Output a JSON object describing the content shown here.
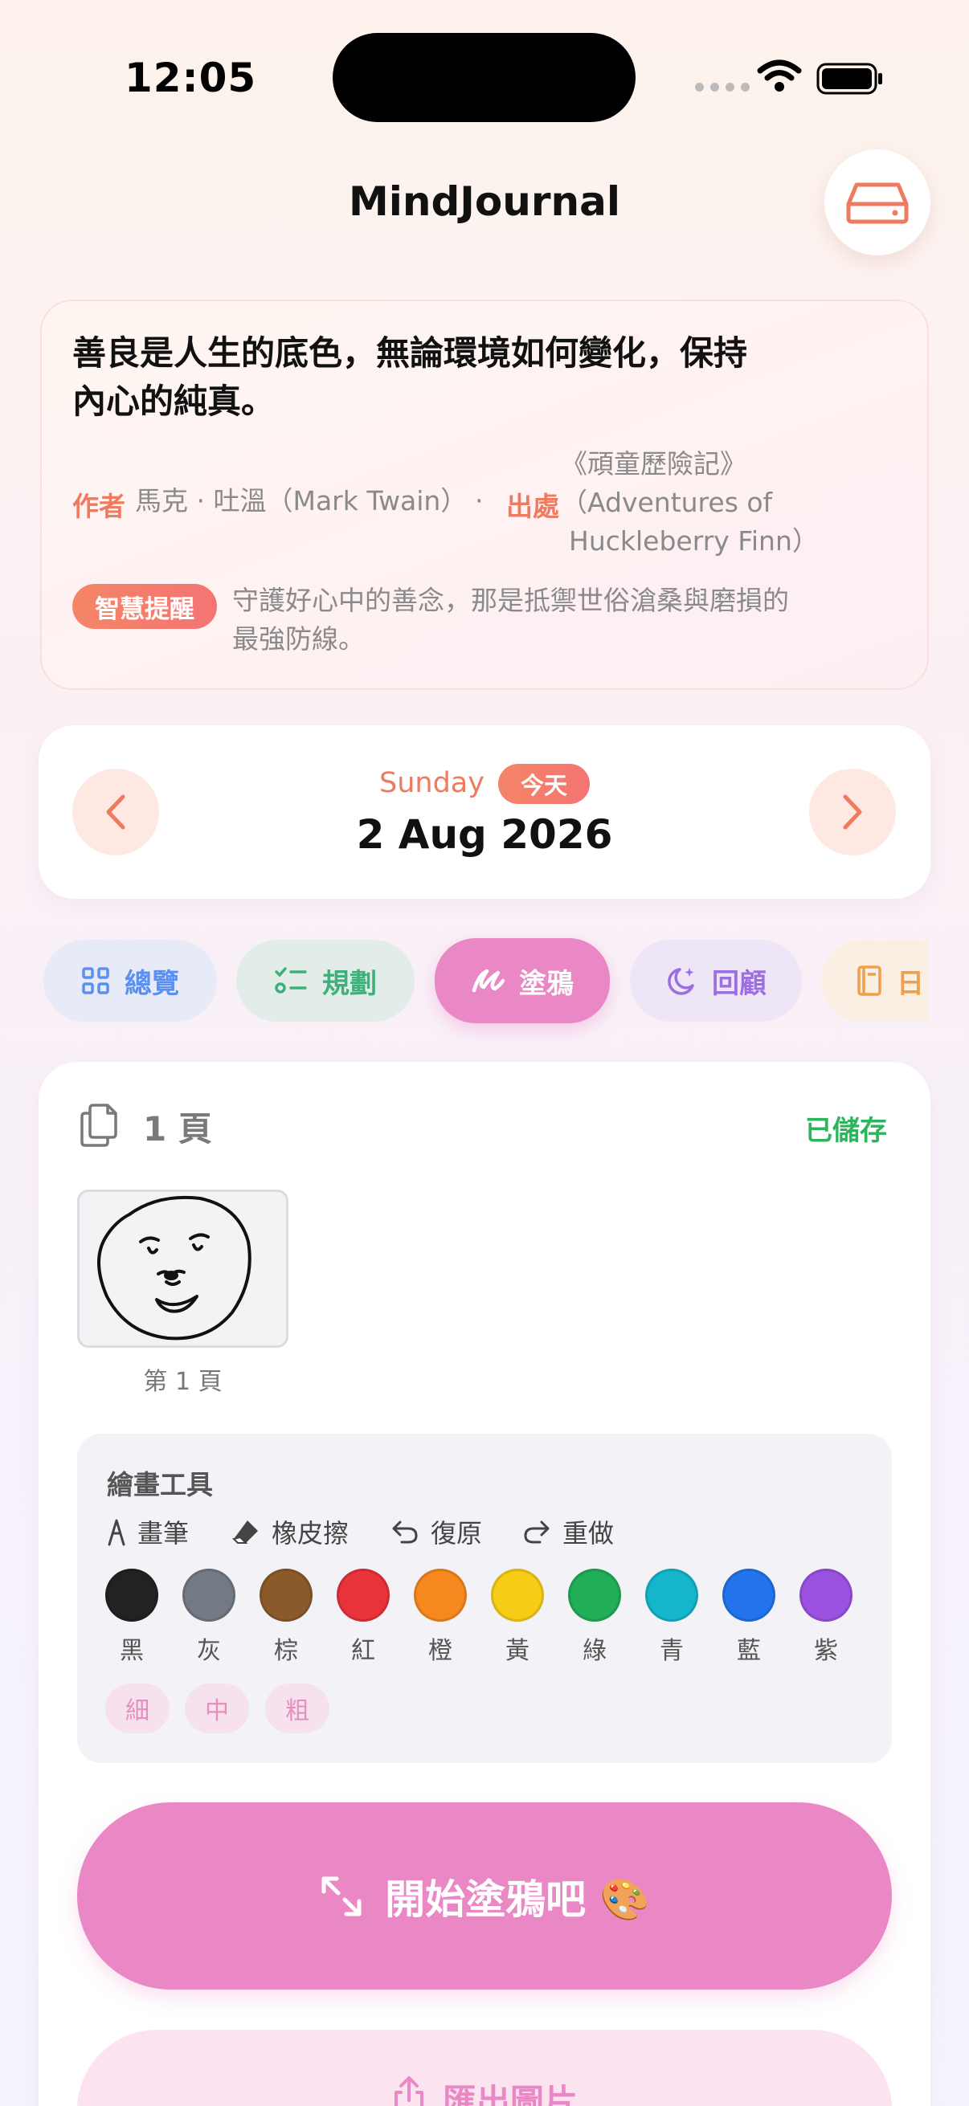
{
  "status_bar": {
    "time": "12:05"
  },
  "header": {
    "title": "MindJournal"
  },
  "quote": {
    "text_line1": "善良是人生的底色，無論環境如何變化，保持",
    "text_line2": "內心的純真。",
    "author_label": "作者",
    "author": "馬克 · 吐溫（Mark Twain）",
    "separator": "·",
    "source_label": "出處",
    "source_line1": "《頑童歷險記》",
    "source_line2": "（Adventures of",
    "source_line3": "Huckleberry Finn）",
    "ai_label": "智慧提醒",
    "ai_line1": "守護好心中的善念，那是抵禦世俗滄桑與磨損的",
    "ai_line2": "最強防線。"
  },
  "date": {
    "day_name": "Sunday",
    "today_badge": "今天",
    "date_text": "2 Aug 2026"
  },
  "tabs": [
    {
      "label": "總覽",
      "color": "#5b8ff0"
    },
    {
      "label": "規劃",
      "color": "#3fb07a"
    },
    {
      "label": "塗鴉",
      "color": "#ffffff"
    },
    {
      "label": "回顧",
      "color": "#9b6fe0"
    },
    {
      "label": "日",
      "color": "#f0a04a"
    }
  ],
  "doodle": {
    "page_count": "1 頁",
    "saved_status": "已儲存",
    "thumb_label": "第 1 頁",
    "tools_title": "繪畫工具",
    "tools": {
      "pen": "畫筆",
      "eraser": "橡皮擦",
      "undo": "復原",
      "redo": "重做"
    },
    "colors": [
      {
        "name": "黑",
        "hex": "#222222"
      },
      {
        "name": "灰",
        "hex": "#737a85"
      },
      {
        "name": "棕",
        "hex": "#8b5a2b"
      },
      {
        "name": "紅",
        "hex": "#e8333b"
      },
      {
        "name": "橙",
        "hex": "#f5891f"
      },
      {
        "name": "黃",
        "hex": "#f7cc16"
      },
      {
        "name": "綠",
        "hex": "#22ad57"
      },
      {
        "name": "青",
        "hex": "#15b5cc"
      },
      {
        "name": "藍",
        "hex": "#2273ec"
      },
      {
        "name": "紫",
        "hex": "#9b51e0"
      }
    ],
    "sizes": [
      "細",
      "中",
      "粗"
    ],
    "start_button": "開始塗鴉吧 🎨",
    "export_button": "匯出圖片"
  }
}
